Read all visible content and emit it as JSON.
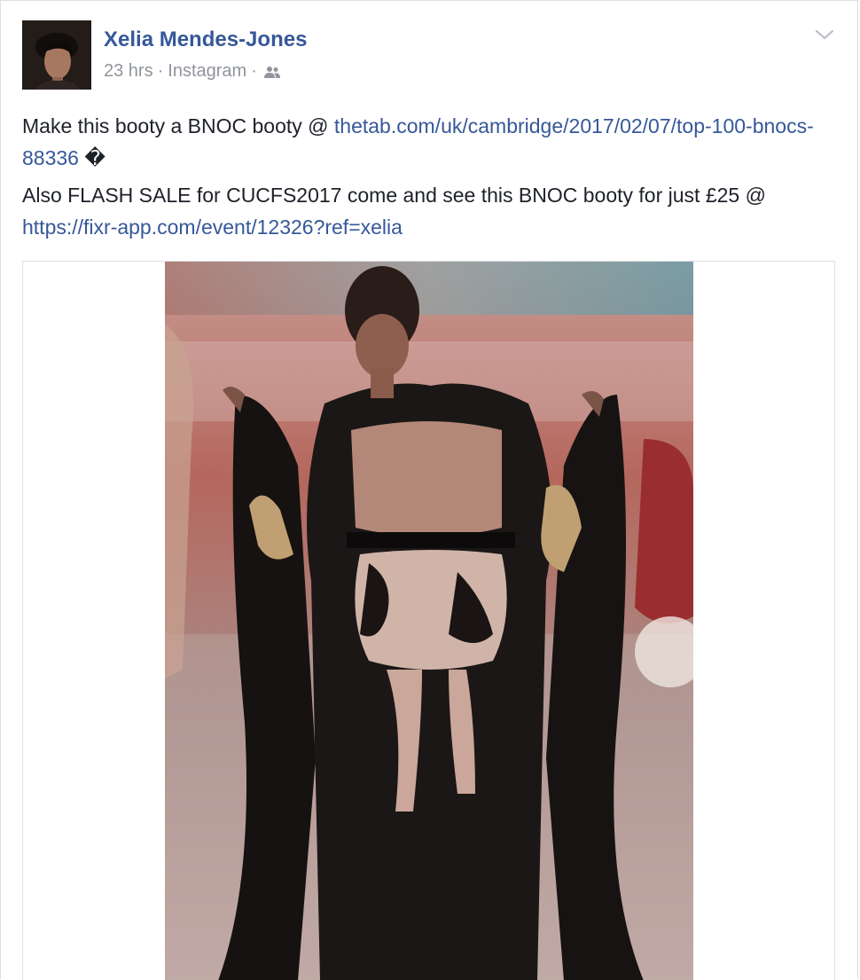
{
  "post": {
    "author": "Xelia Mendes-Jones",
    "time": "23 hrs",
    "source": "Instagram",
    "separator": "·",
    "audience_icon": "friends-icon",
    "menu_icon": "chevron-down-icon",
    "paragraph1": {
      "text": "Make this booty a BNOC booty @ ",
      "link": "thetab.com/uk/cambridge/2017/02/07/top-100-bnocs-88336",
      "suffix": " �"
    },
    "paragraph2": {
      "text": "Also FLASH SALE for CUCFS2017 come and see this BNOC booty for just £25 @ ",
      "link": "https://fixr-app.com/event/12326?ref=xelia"
    }
  },
  "colors": {
    "link": "#365899",
    "text": "#1d2129",
    "meta": "#90949c",
    "border": "#dddfe2"
  }
}
